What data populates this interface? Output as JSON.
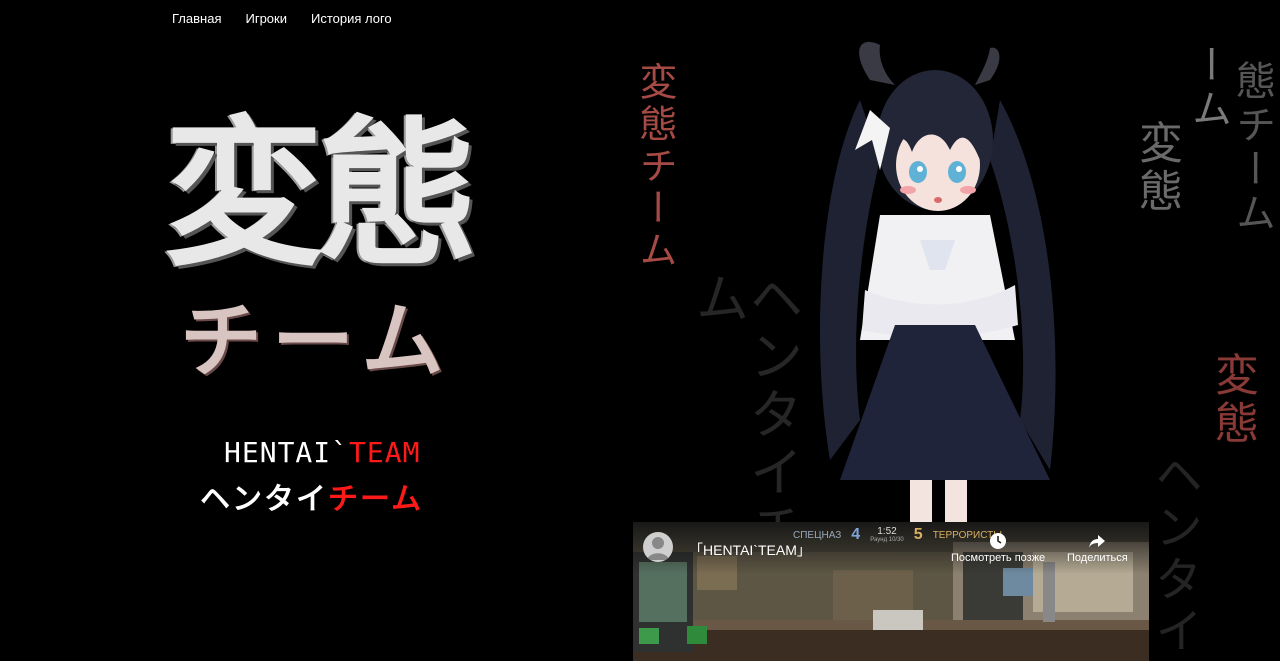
{
  "nav": {
    "items": [
      "Главная",
      "Игроки",
      "История лого"
    ]
  },
  "logo": {
    "kanji": "変態",
    "kana": "チーム"
  },
  "brand": {
    "latin_white": "HENTAI`",
    "latin_red": "TEAM",
    "kana_white": "ヘンタイ",
    "kana_red": "チーム"
  },
  "background_text": {
    "col_red_top": "変態チーム",
    "col_dim_center": "ヘンタイチーム",
    "col_right_1": "ーム",
    "col_right_2": "変態",
    "col_right_3": "態チーム",
    "col_right_red": "変態",
    "col_dim_right": "ヘンタイ"
  },
  "video": {
    "title": "「HENTAI`TEAM」",
    "score": {
      "ct_label": "СПЕЦНАЗ",
      "ct_score": "4",
      "time": "1:52",
      "round": "Раунд 10/30",
      "t_score": "5",
      "t_label": "ТЕРРОРИСТЫ"
    },
    "watch_later": "Посмотреть позже",
    "share": "Поделиться"
  },
  "colors": {
    "background": "#000000",
    "accent_red": "#ff1a1a",
    "bg_kanji_red": "#a64a46"
  }
}
